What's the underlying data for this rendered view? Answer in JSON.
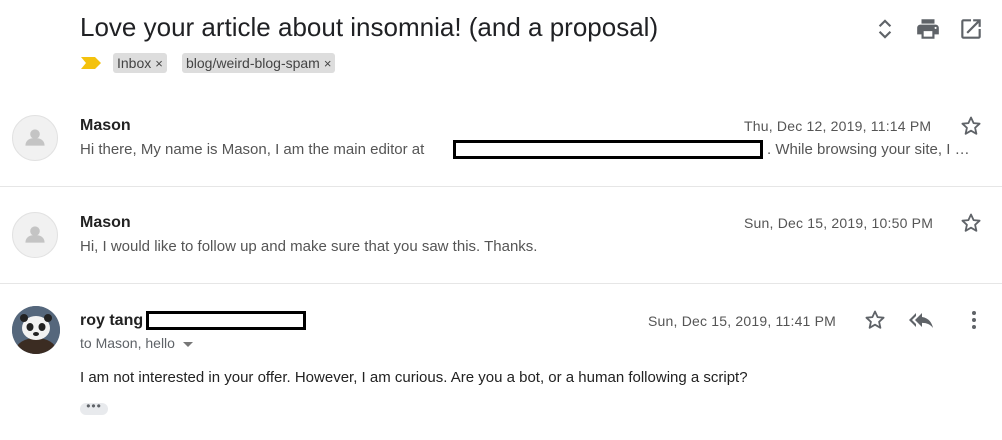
{
  "thread": {
    "subject": "Love your article about insomnia! (and a proposal)",
    "labels": [
      {
        "name": "Inbox",
        "remove": "×"
      },
      {
        "name": "blog/weird-blog-spam",
        "remove": "×"
      }
    ]
  },
  "toolbar": {
    "icons": [
      "expand-collapse-icon",
      "print-icon",
      "open-in-new-window-icon"
    ]
  },
  "messages": [
    {
      "sender": "Mason",
      "date": "Thu, Dec 12, 2019, 11:14 PM",
      "snippet_before": "Hi there, My name is Mason, I am the main editor at",
      "snippet_after": ". While browsing your site, I …"
    },
    {
      "sender": "Mason",
      "date": "Sun, Dec 15, 2019, 10:50 PM",
      "snippet": "Hi, I would like to follow up and make sure that you saw this. Thanks."
    },
    {
      "sender": "roy tang",
      "date": "Sun, Dec 15, 2019, 11:41 PM",
      "recipients": "to Mason, hello",
      "body": "I am not interested in your offer. However, I am curious. Are you a bot, or a human following a script?",
      "trimmed_content": "•••"
    }
  ],
  "colors": {
    "importance_marker": "#f4c20d",
    "label_chip": "#dddddd",
    "icon": "#5f6368",
    "redaction": "#000000"
  }
}
